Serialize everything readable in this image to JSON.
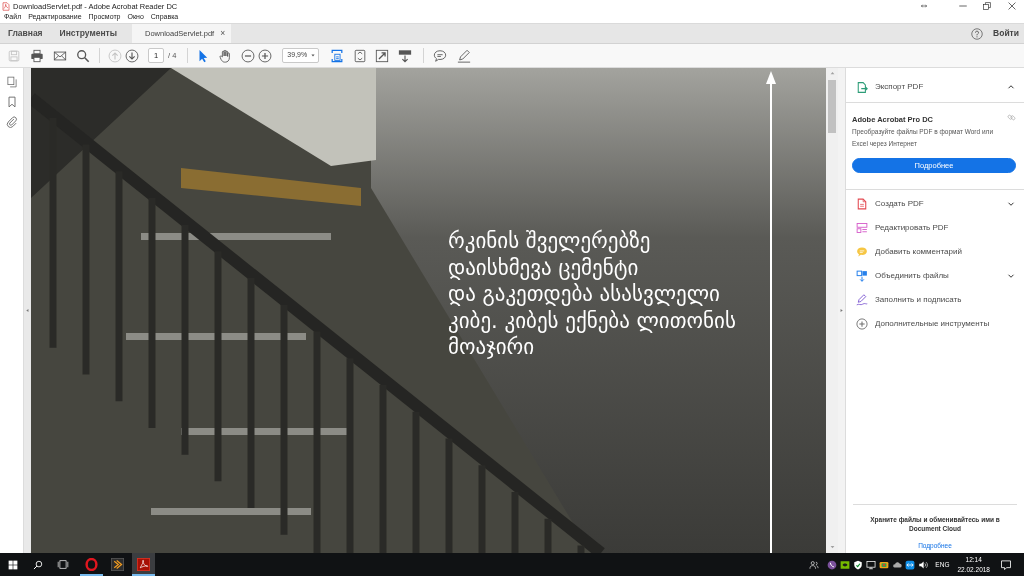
{
  "window": {
    "title": "DownloadServlet.pdf - Adobe Acrobat Reader DC"
  },
  "menu": [
    "Файл",
    "Редактирование",
    "Просмотр",
    "Окно",
    "Справка"
  ],
  "tabs": [
    {
      "kind": "section",
      "label": "Главная",
      "selected": false
    },
    {
      "kind": "section",
      "label": "Инструменты",
      "selected": false
    },
    {
      "kind": "document",
      "label": "DownloadServlet.pdf",
      "close": "×",
      "selected": true
    }
  ],
  "account": {
    "sign_in": "Войти"
  },
  "toolbar": {
    "file_tools": [
      {
        "kind": "save",
        "disabled": true
      },
      {
        "kind": "print",
        "disabled": false
      },
      {
        "kind": "mail",
        "disabled": false
      },
      {
        "kind": "search",
        "disabled": false
      }
    ],
    "page_nav": [
      {
        "kind": "up",
        "disabled": true
      },
      {
        "kind": "down",
        "disabled": false
      }
    ],
    "page": {
      "value": "1",
      "total": "/ 4"
    },
    "pointer_tools": [
      {
        "kind": "select",
        "selected": true
      },
      {
        "kind": "hand",
        "selected": false
      }
    ],
    "zoom_buttons": [
      {
        "kind": "zoom-out"
      },
      {
        "kind": "zoom-in"
      }
    ],
    "zoom": {
      "value": "39,9%"
    },
    "view_tools": [
      {
        "kind": "scroll-mode",
        "selected": true
      },
      {
        "kind": "fit-page",
        "selected": false
      },
      {
        "kind": "full-screen",
        "selected": false
      },
      {
        "kind": "read-mode",
        "selected": false
      }
    ],
    "annotate_tools": [
      {
        "kind": "comment"
      },
      {
        "kind": "sign"
      }
    ]
  },
  "left_rail": [
    {
      "kind": "pages"
    },
    {
      "kind": "bookmarks"
    },
    {
      "kind": "attachments"
    }
  ],
  "document": {
    "caption_lines": [
      "რკინის შველერებზე",
      "დაისხმევა ცემენტი",
      "და გაკეთდება ასასვლელი",
      "კიბე. კიბეს ექნება ლითონის",
      "მოაჯირი"
    ]
  },
  "right_panel": {
    "export": {
      "label": "Экспорт PDF",
      "expanded": true
    },
    "promo": {
      "title": "Adobe Acrobat Pro DC",
      "text": "Преобразуйте файлы PDF в формат Word или Excel через Интернет",
      "button": "Подробнее"
    },
    "tools": [
      {
        "kind": "create",
        "label": "Создать PDF",
        "expandable": true
      },
      {
        "kind": "edit",
        "label": "Редактировать PDF",
        "expandable": false
      },
      {
        "kind": "comment",
        "label": "Добавить комментарий",
        "expandable": false
      },
      {
        "kind": "combine",
        "label": "Объединить файлы",
        "expandable": true
      },
      {
        "kind": "fill-sign",
        "label": "Заполнить и подписать",
        "expandable": false
      },
      {
        "kind": "more",
        "label": "Дополнительные инструменты",
        "expandable": false
      }
    ],
    "cloud": {
      "text": "Храните файлы и обменивайтесь ими в Document Cloud",
      "link": "Подробнее"
    }
  },
  "taskbar": {
    "apps": [
      {
        "kind": "browser",
        "running": true,
        "focused": false
      },
      {
        "kind": "launcher",
        "running": false,
        "focused": false
      },
      {
        "kind": "pdf-reader",
        "running": true,
        "focused": true
      }
    ],
    "language": "ENG",
    "time": "12:14",
    "date": "22.02.2018"
  }
}
